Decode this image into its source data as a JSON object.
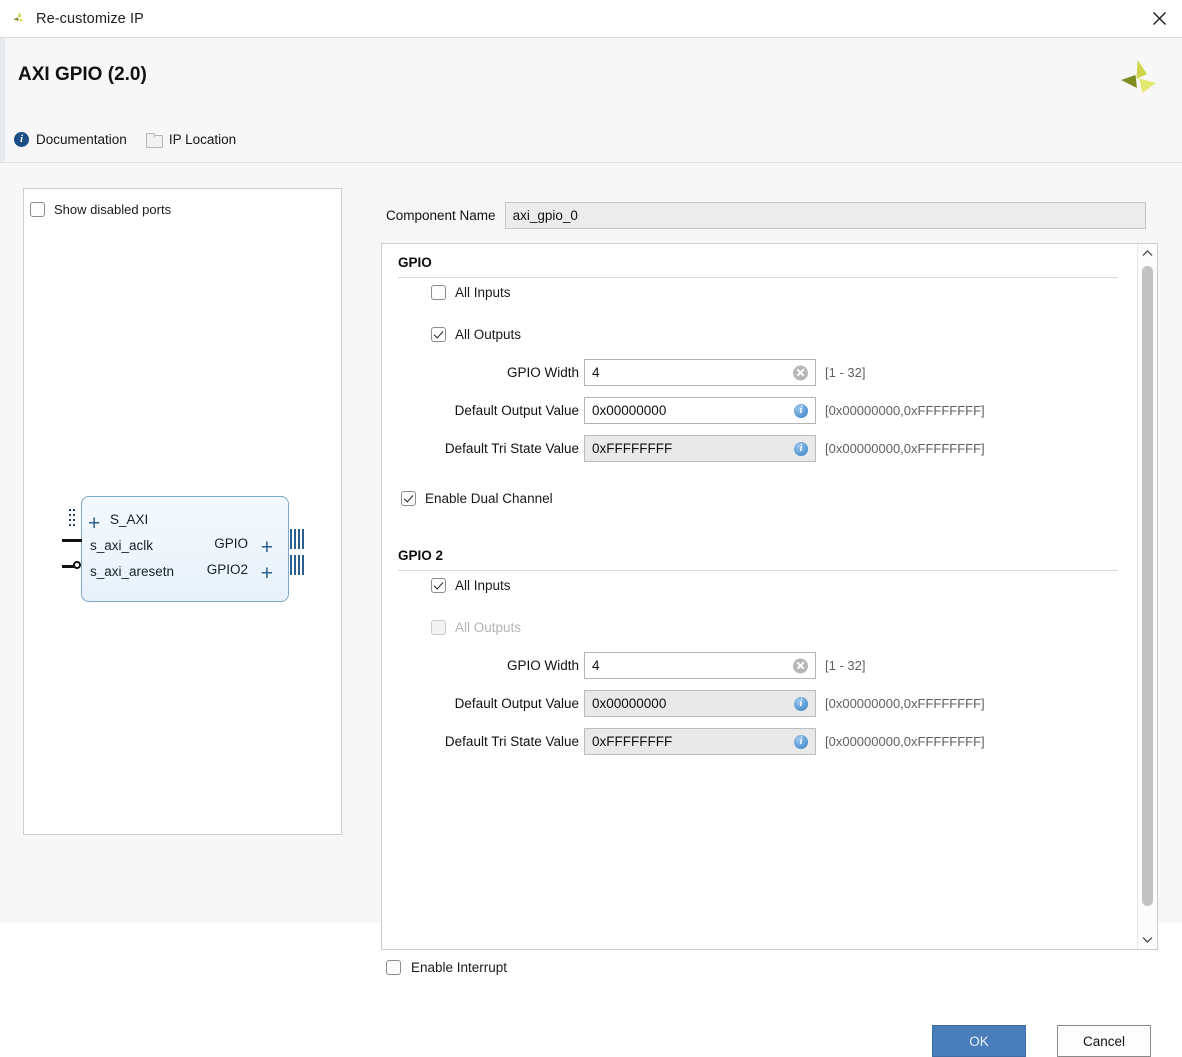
{
  "window": {
    "title": "Re-customize IP",
    "app_icon": "xilinx-logo-icon",
    "close_icon": "close-icon"
  },
  "header": {
    "title": "AXI GPIO (2.0)",
    "logo": "amd-xilinx-logo",
    "links": [
      {
        "label": "Documentation",
        "icon": "info-circle-icon"
      },
      {
        "label": "IP Location",
        "icon": "folder-icon"
      }
    ]
  },
  "diagram": {
    "show_disabled_ports": {
      "label": "Show disabled ports",
      "checked": false
    },
    "symbol": {
      "left_ports": [
        "S_AXI",
        "s_axi_aclk",
        "s_axi_aresetn"
      ],
      "right_ports": [
        "GPIO",
        "GPIO2"
      ],
      "expand_icon": "plus-icon"
    }
  },
  "component": {
    "label": "Component Name",
    "value": "axi_gpio_0"
  },
  "gpio": {
    "title": "GPIO",
    "all_inputs": {
      "label": "All Inputs",
      "checked": false,
      "disabled": false
    },
    "all_outputs": {
      "label": "All Outputs",
      "checked": true,
      "disabled": false
    },
    "width": {
      "label": "GPIO Width",
      "value": "4",
      "range": "[1 - 32]",
      "icon": "clear-icon",
      "disabled": false
    },
    "default_output": {
      "label": "Default Output Value",
      "value": "0x00000000",
      "range": "[0x00000000,0xFFFFFFFF]",
      "icon": "info-icon",
      "disabled": false
    },
    "default_tri_state": {
      "label": "Default Tri State Value",
      "value": "0xFFFFFFFF",
      "range": "[0x00000000,0xFFFFFFFF]",
      "icon": "info-icon",
      "disabled": true
    }
  },
  "dual_channel": {
    "label": "Enable Dual Channel",
    "checked": true
  },
  "gpio2": {
    "title": "GPIO 2",
    "all_inputs": {
      "label": "All Inputs",
      "checked": true,
      "disabled": false
    },
    "all_outputs": {
      "label": "All Outputs",
      "checked": false,
      "disabled": true
    },
    "width": {
      "label": "GPIO Width",
      "value": "4",
      "range": "[1 - 32]",
      "icon": "clear-icon",
      "disabled": false
    },
    "default_output": {
      "label": "Default Output Value",
      "value": "0x00000000",
      "range": "[0x00000000,0xFFFFFFFF]",
      "icon": "info-icon",
      "disabled": true
    },
    "default_tri_state": {
      "label": "Default Tri State Value",
      "value": "0xFFFFFFFF",
      "range": "[0x00000000,0xFFFFFFFF]",
      "icon": "info-icon",
      "disabled": true
    }
  },
  "interrupt": {
    "label": "Enable Interrupt",
    "checked": false
  },
  "footer": {
    "ok": "OK",
    "cancel": "Cancel"
  },
  "scrollbar": {
    "up_icon": "chevron-up-icon",
    "down_icon": "chevron-down-icon"
  },
  "colors": {
    "accent": "#4a7ebb",
    "info": "#2f7fc6",
    "symbol_border": "#7ea6c8"
  }
}
